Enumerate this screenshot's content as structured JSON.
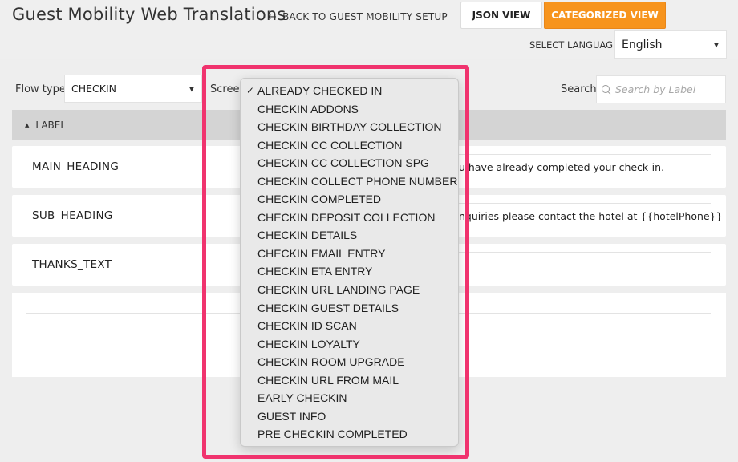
{
  "header": {
    "title": "Guest Mobility Web Translations",
    "back_link": "BACK TO GUEST MOBILITY SETUP",
    "json_view_button": "JSON VIEW",
    "categorized_view_button": "CATEGORIZED VIEW",
    "language_label": "SELECT LANGUAGE",
    "language_value": "English"
  },
  "filters": {
    "flow_type_label": "Flow type",
    "flow_type_value": "CHECKIN",
    "screen_label": "Screen",
    "search_label": "Search",
    "search_placeholder": "Search by Label"
  },
  "table": {
    "label_header": "LABEL",
    "rows": [
      {
        "label": "MAIN_HEADING",
        "value": "u have already completed your check-in."
      },
      {
        "label": "SUB_HEADING",
        "value": "nquiries please contact the hotel at {{hotelPhone}}"
      },
      {
        "label": "THANKS_TEXT",
        "value": ""
      }
    ]
  },
  "screen_dropdown": {
    "selected_index": 0,
    "options": [
      "ALREADY CHECKED IN",
      "CHECKIN ADDONS",
      "CHECKIN BIRTHDAY COLLECTION",
      "CHECKIN CC COLLECTION",
      "CHECKIN CC COLLECTION SPG",
      "CHECKIN COLLECT PHONE NUMBER",
      "CHECKIN COMPLETED",
      "CHECKIN DEPOSIT COLLECTION",
      "CHECKIN DETAILS",
      "CHECKIN EMAIL ENTRY",
      "CHECKIN ETA ENTRY",
      "CHECKIN URL LANDING PAGE",
      "CHECKIN GUEST DETAILS",
      "CHECKIN ID SCAN",
      "CHECKIN LOYALTY",
      "CHECKIN ROOM UPGRADE",
      "CHECKIN URL FROM MAIL",
      "EARLY CHECKIN",
      "GUEST INFO",
      "PRE CHECKIN COMPLETED"
    ]
  },
  "icons": {
    "back": "arrow-left-icon",
    "caret": "caret-down-icon",
    "search": "search-icon",
    "sort": "sort-up-icon",
    "check": "checkmark-icon"
  },
  "colors": {
    "accent": "#f7941d",
    "highlight": "#f0336e"
  }
}
